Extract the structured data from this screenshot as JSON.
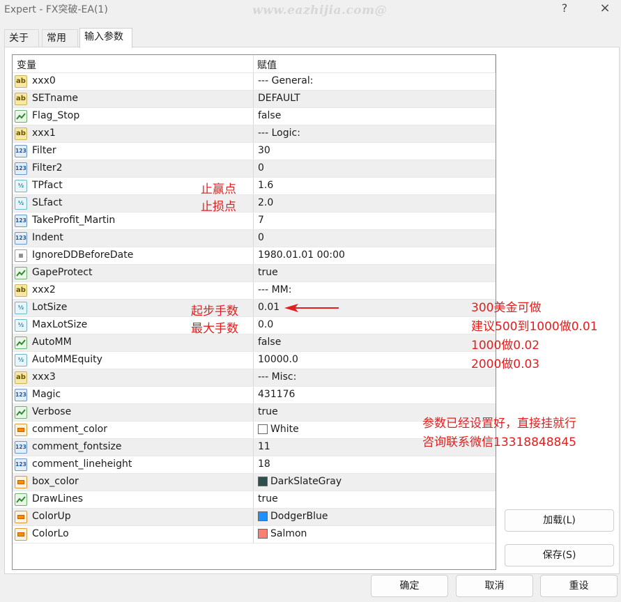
{
  "window": {
    "title": "Expert - FX突破-EA(1)",
    "watermark": "www.eazhijia.com@",
    "help_label": "?",
    "close_label": "×"
  },
  "tabs": [
    {
      "label": "关于"
    },
    {
      "label": "常用"
    },
    {
      "label": "输入参数",
      "active": true
    }
  ],
  "table": {
    "headers": {
      "variable": "变量",
      "value": "赋值"
    },
    "rows": [
      {
        "type": "str",
        "name": "xxx0",
        "value": "--- General:"
      },
      {
        "type": "str",
        "name": "SETname",
        "value": "DEFAULT"
      },
      {
        "type": "bool",
        "name": "Flag_Stop",
        "value": "false"
      },
      {
        "type": "str",
        "name": "xxx1",
        "value": "--- Logic:"
      },
      {
        "type": "int",
        "name": "Filter",
        "value": "30"
      },
      {
        "type": "int",
        "name": "Filter2",
        "value": "0"
      },
      {
        "type": "dbl",
        "name": "TPfact",
        "value": "1.6"
      },
      {
        "type": "dbl",
        "name": "SLfact",
        "value": "2.0"
      },
      {
        "type": "int",
        "name": "TakeProfit_Martin",
        "value": "7"
      },
      {
        "type": "int",
        "name": "Indent",
        "value": "0"
      },
      {
        "type": "date",
        "name": "IgnoreDDBeforeDate",
        "value": "1980.01.01 00:00"
      },
      {
        "type": "bool",
        "name": "GapeProtect",
        "value": "true"
      },
      {
        "type": "str",
        "name": "xxx2",
        "value": "--- MM:"
      },
      {
        "type": "dbl",
        "name": "LotSize",
        "value": "0.01"
      },
      {
        "type": "dbl",
        "name": "MaxLotSize",
        "value": "0.0"
      },
      {
        "type": "bool",
        "name": "AutoMM",
        "value": "false"
      },
      {
        "type": "dbl",
        "name": "AutoMMEquity",
        "value": "10000.0"
      },
      {
        "type": "str",
        "name": "xxx3",
        "value": "--- Misc:"
      },
      {
        "type": "int",
        "name": "Magic",
        "value": "431176"
      },
      {
        "type": "bool",
        "name": "Verbose",
        "value": "true"
      },
      {
        "type": "color",
        "name": "comment_color",
        "value": "White",
        "swatch": "#ffffff"
      },
      {
        "type": "int",
        "name": "comment_fontsize",
        "value": "11"
      },
      {
        "type": "int",
        "name": "comment_lineheight",
        "value": "18"
      },
      {
        "type": "color",
        "name": "box_color",
        "value": "DarkSlateGray",
        "swatch": "#2f4f4f"
      },
      {
        "type": "bool",
        "name": "DrawLines",
        "value": "true"
      },
      {
        "type": "color",
        "name": "ColorUp",
        "value": "DodgerBlue",
        "swatch": "#1e90ff"
      },
      {
        "type": "color",
        "name": "ColorLo",
        "value": "Salmon",
        "swatch": "#fa8072"
      }
    ]
  },
  "annotations": {
    "tp": "止赢点",
    "sl": "止损点",
    "lot": "起步手数",
    "maxlot": "最大手数",
    "advice1": "300美金可做",
    "advice2": "建议500到1000做0.01",
    "advice3": "1000做0.02",
    "advice4": "2000做0.03",
    "note1": "参数已经设置好，直接挂就行",
    "note2": "咨询联系微信13318848845",
    "color": "#e02020"
  },
  "buttons": {
    "load": "加载(L)",
    "save": "保存(S)",
    "ok": "确定",
    "cancel": "取消",
    "reset": "重设"
  }
}
